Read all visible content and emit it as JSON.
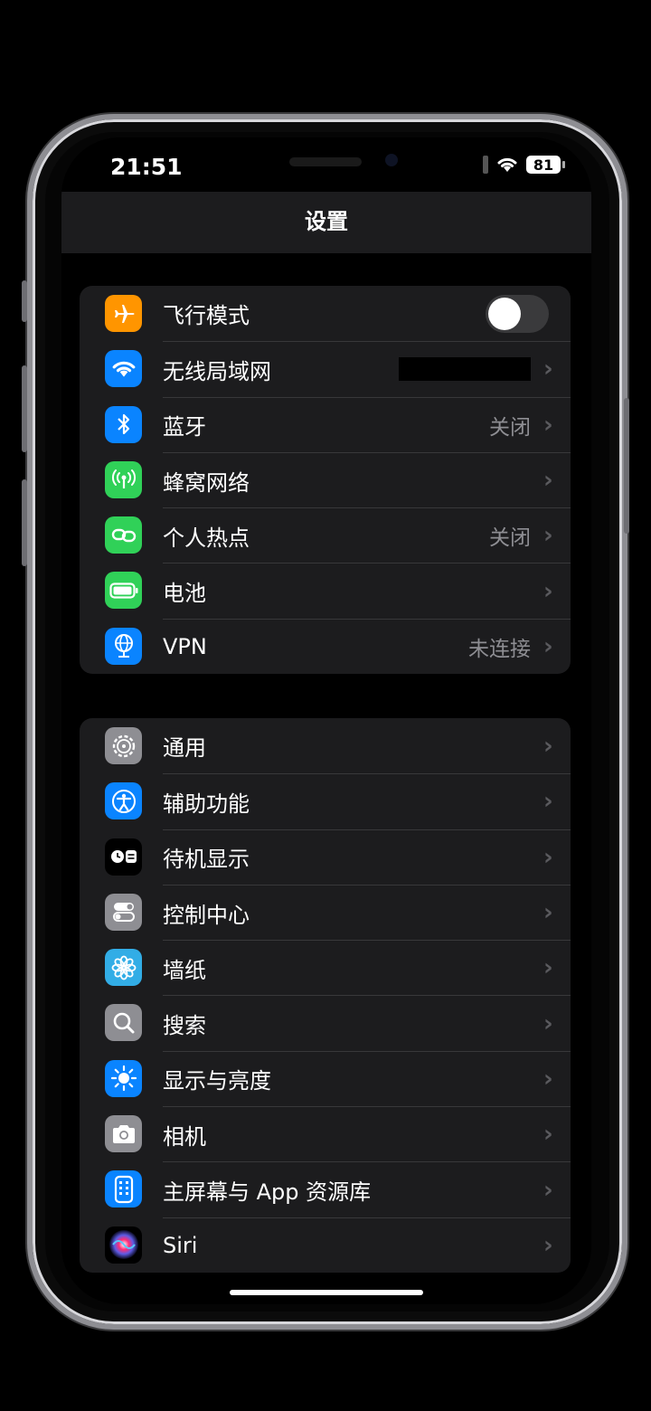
{
  "status": {
    "time": "21:51",
    "battery": "81"
  },
  "header": {
    "title": "设置"
  },
  "group1": [
    {
      "label": "飞行模式",
      "icon": "airplane-icon",
      "color": "#ff9500",
      "type": "toggle",
      "toggle_on": false
    },
    {
      "label": "无线局域网",
      "icon": "wifi-icon",
      "color": "#0a84ff",
      "type": "redacted"
    },
    {
      "label": "蓝牙",
      "icon": "bluetooth-icon",
      "color": "#0a84ff",
      "value": "关闭"
    },
    {
      "label": "蜂窝网络",
      "icon": "cellular-icon",
      "color": "#30d158"
    },
    {
      "label": "个人热点",
      "icon": "hotspot-icon",
      "color": "#30d158",
      "value": "关闭"
    },
    {
      "label": "电池",
      "icon": "battery-icon",
      "color": "#30d158"
    },
    {
      "label": "VPN",
      "icon": "vpn-globe-icon",
      "color": "#0a84ff",
      "value": "未连接"
    }
  ],
  "group2": [
    {
      "label": "通用",
      "icon": "gear-icon",
      "color": "#8e8e93"
    },
    {
      "label": "辅助功能",
      "icon": "accessibility-icon",
      "color": "#0a84ff"
    },
    {
      "label": "待机显示",
      "icon": "standby-icon",
      "color": "#000000"
    },
    {
      "label": "控制中心",
      "icon": "control-center-icon",
      "color": "#8e8e93"
    },
    {
      "label": "墙纸",
      "icon": "wallpaper-flower-icon",
      "color": "#32ade6"
    },
    {
      "label": "搜索",
      "icon": "search-icon",
      "color": "#8e8e93"
    },
    {
      "label": "显示与亮度",
      "icon": "brightness-sun-icon",
      "color": "#0a84ff"
    },
    {
      "label": "相机",
      "icon": "camera-icon",
      "color": "#8e8e93"
    },
    {
      "label": "主屏幕与 App 资源库",
      "icon": "home-screen-icon",
      "color": "#0a84ff"
    },
    {
      "label": "Siri",
      "icon": "siri-icon",
      "color": "#000000"
    }
  ],
  "chevron": "›"
}
